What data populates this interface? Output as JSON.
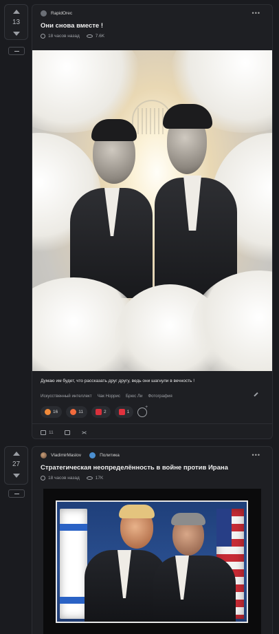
{
  "posts": [
    {
      "votes": "13",
      "author": "RapidOrec",
      "title": "Они снова вместе !",
      "time": "18 часов назад",
      "views": "7.6K",
      "caption": "Думаю им будет, что рассказать друг другу, ведь они шагнули в вечность !",
      "tags": [
        "Искусственный интеллект",
        "Чак Норрис",
        "Брюс Ли",
        "Фотография"
      ],
      "reactions": [
        {
          "icon": "laughing-emoji-icon",
          "count": "16",
          "color": "#f08a3a"
        },
        {
          "icon": "angry-emoji-icon",
          "count": "11",
          "color": "#f26b3d"
        },
        {
          "icon": "broken-heart-icon",
          "count": "2",
          "color": "#d8313c"
        },
        {
          "icon": "heart-icon",
          "count": "1",
          "color": "#e2323e"
        }
      ],
      "comments": "11"
    },
    {
      "votes": "27",
      "author": "VladimirMaslov",
      "community": "Политика",
      "title": "Стратегическая неопределённость в войне против Ирана",
      "time": "18 часов назад",
      "views": "17K"
    }
  ]
}
